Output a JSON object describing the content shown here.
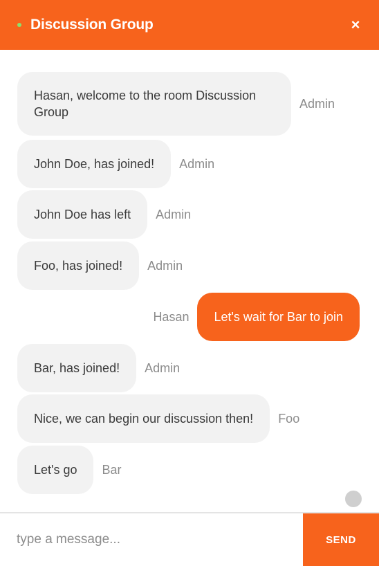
{
  "header": {
    "title": "Discussion Group",
    "close_label": "×",
    "color": "#f7631c"
  },
  "messages": [
    {
      "text": "Hasan, welcome to the room Discussion Group",
      "sender": "Admin",
      "mine": false
    },
    {
      "text": "John Doe, has joined!",
      "sender": "Admin",
      "mine": false
    },
    {
      "text": "John Doe has left",
      "sender": "Admin",
      "mine": false
    },
    {
      "text": "Foo, has joined!",
      "sender": "Admin",
      "mine": false
    },
    {
      "text": "Let's wait for Bar to join",
      "sender": "Hasan",
      "mine": true
    },
    {
      "text": "Bar, has joined!",
      "sender": "Admin",
      "mine": false
    },
    {
      "text": "Nice, we can begin our discussion then!",
      "sender": "Foo",
      "mine": false
    },
    {
      "text": "Let's go",
      "sender": "Bar",
      "mine": false
    }
  ],
  "composer": {
    "placeholder": "type a message...",
    "send_label": "SEND"
  }
}
